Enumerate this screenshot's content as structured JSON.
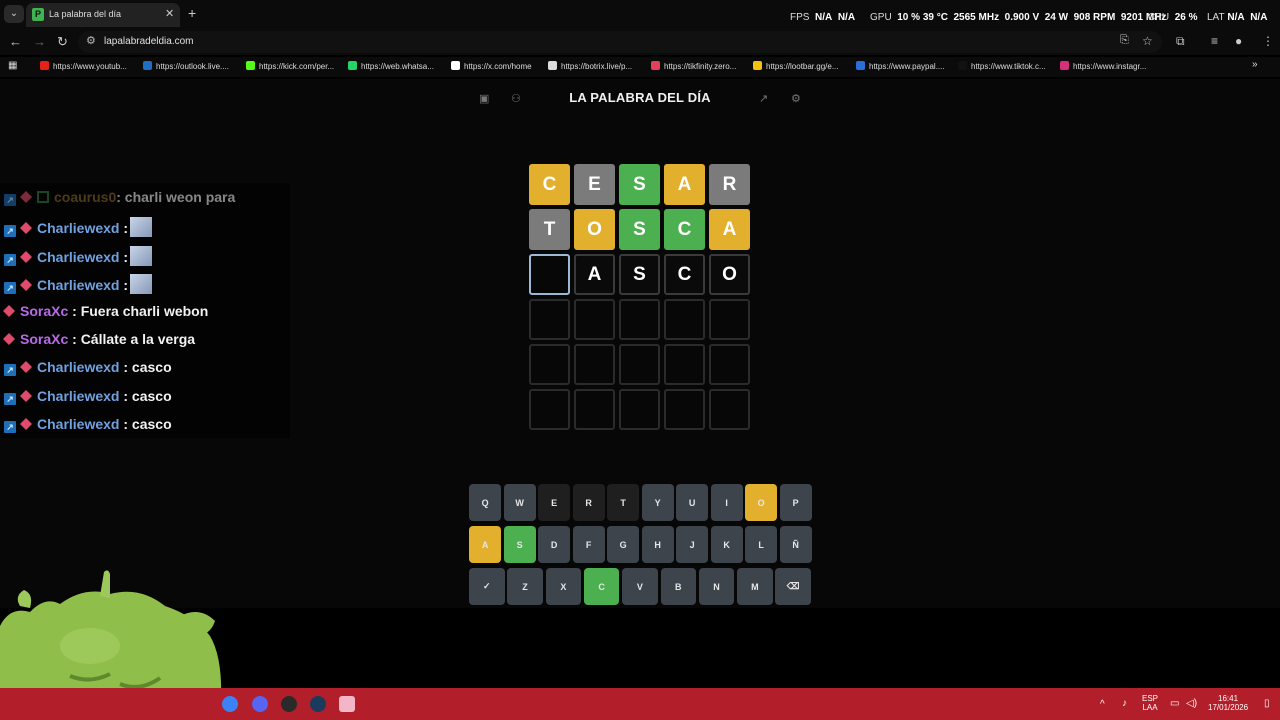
{
  "browser": {
    "tab_title": "La palabra del día",
    "tab_favicon": "P",
    "url": "lapalabradeldia.com",
    "bookmarks": [
      {
        "label": "https://www.youtub...",
        "icon": "youtube-icon",
        "color": "#e62117"
      },
      {
        "label": "https://outlook.live....",
        "icon": "outlook-icon",
        "color": "#1f6fc5"
      },
      {
        "label": "https://kick.com/per...",
        "icon": "kick-icon",
        "color": "#53fc18"
      },
      {
        "label": "https://web.whatsa...",
        "icon": "whatsapp-icon",
        "color": "#25d366"
      },
      {
        "label": "https://x.com/home",
        "icon": "x-icon",
        "color": "#ffffff"
      },
      {
        "label": "https://botrix.live/p...",
        "icon": "botrix-icon",
        "color": "#dddddd"
      },
      {
        "label": "https://tikfinity.zero...",
        "icon": "tikfinity-icon",
        "color": "#e0405a"
      },
      {
        "label": "https://lootbar.gg/e...",
        "icon": "lootbar-icon",
        "color": "#f4c20d"
      },
      {
        "label": "https://www.paypal....",
        "icon": "paypal-icon",
        "color": "#2b6fd6"
      },
      {
        "label": "https://www.tiktok.c...",
        "icon": "tiktok-icon",
        "color": "#111111"
      },
      {
        "label": "https://www.instagr...",
        "icon": "instagram-icon",
        "color": "#d6307a"
      }
    ]
  },
  "hud": {
    "fps_label": "FPS",
    "fps_value": "N/A",
    "fps_value2": "N/A",
    "gpu_label": "GPU",
    "gpu_usage": "10 %",
    "gpu_temp": "39 °C",
    "gpu_clock": "2565 MHz",
    "gpu_volt": "0.900 V",
    "gpu_power": "24 W",
    "gpu_fan": "908 RPM",
    "gpu_mem": "9201 MHz",
    "cpu_label": "CPU",
    "cpu_usage": "26 %",
    "lat_label": "LAT",
    "lat_value": "N/A",
    "lat_value2": "N/A"
  },
  "game": {
    "title": "LA PALABRA DEL DÍA",
    "rows": [
      [
        {
          "l": "C",
          "s": "y"
        },
        {
          "l": "E",
          "s": "x"
        },
        {
          "l": "S",
          "s": "g"
        },
        {
          "l": "A",
          "s": "y"
        },
        {
          "l": "R",
          "s": "x"
        }
      ],
      [
        {
          "l": "T",
          "s": "x"
        },
        {
          "l": "O",
          "s": "y"
        },
        {
          "l": "S",
          "s": "g"
        },
        {
          "l": "C",
          "s": "g"
        },
        {
          "l": "A",
          "s": "y"
        }
      ],
      [
        {
          "l": "",
          "s": "cur"
        },
        {
          "l": "A",
          "s": "typed"
        },
        {
          "l": "S",
          "s": "typed"
        },
        {
          "l": "C",
          "s": "typed"
        },
        {
          "l": "O",
          "s": "typed"
        }
      ],
      [
        {
          "l": "",
          "s": ""
        },
        {
          "l": "",
          "s": ""
        },
        {
          "l": "",
          "s": ""
        },
        {
          "l": "",
          "s": ""
        },
        {
          "l": "",
          "s": ""
        }
      ],
      [
        {
          "l": "",
          "s": ""
        },
        {
          "l": "",
          "s": ""
        },
        {
          "l": "",
          "s": ""
        },
        {
          "l": "",
          "s": ""
        },
        {
          "l": "",
          "s": ""
        }
      ],
      [
        {
          "l": "",
          "s": ""
        },
        {
          "l": "",
          "s": ""
        },
        {
          "l": "",
          "s": ""
        },
        {
          "l": "",
          "s": ""
        },
        {
          "l": "",
          "s": ""
        }
      ]
    ],
    "keyboard": [
      [
        {
          "k": "Q",
          "s": ""
        },
        {
          "k": "W",
          "s": ""
        },
        {
          "k": "E",
          "s": "x"
        },
        {
          "k": "R",
          "s": "x"
        },
        {
          "k": "T",
          "s": "x"
        },
        {
          "k": "Y",
          "s": ""
        },
        {
          "k": "U",
          "s": ""
        },
        {
          "k": "I",
          "s": ""
        },
        {
          "k": "O",
          "s": "y"
        },
        {
          "k": "P",
          "s": ""
        }
      ],
      [
        {
          "k": "A",
          "s": "y"
        },
        {
          "k": "S",
          "s": "g"
        },
        {
          "k": "D",
          "s": ""
        },
        {
          "k": "F",
          "s": ""
        },
        {
          "k": "G",
          "s": ""
        },
        {
          "k": "H",
          "s": ""
        },
        {
          "k": "J",
          "s": ""
        },
        {
          "k": "K",
          "s": ""
        },
        {
          "k": "L",
          "s": ""
        },
        {
          "k": "Ñ",
          "s": ""
        }
      ],
      [
        {
          "k": "✓",
          "s": "",
          "name": "enter-key"
        },
        {
          "k": "Z",
          "s": ""
        },
        {
          "k": "X",
          "s": ""
        },
        {
          "k": "C",
          "s": "g"
        },
        {
          "k": "V",
          "s": ""
        },
        {
          "k": "B",
          "s": ""
        },
        {
          "k": "N",
          "s": ""
        },
        {
          "k": "M",
          "s": ""
        },
        {
          "k": "⌫",
          "s": "",
          "name": "backspace-key"
        }
      ]
    ]
  },
  "chat": [
    {
      "badges": [
        "a",
        "g",
        "t"
      ],
      "user": "coaurus0",
      "color": "#8a6a2a",
      "msg": ": charli weon para",
      "dim": true
    },
    {
      "badges": [
        "a",
        "g"
      ],
      "user": "Charliewexd",
      "color": "#6fa2e0",
      "msg": " :",
      "emote": true
    },
    {
      "badges": [
        "a",
        "g"
      ],
      "user": "Charliewexd",
      "color": "#6fa2e0",
      "msg": " :",
      "emote": true
    },
    {
      "badges": [
        "a",
        "g"
      ],
      "user": "Charliewexd",
      "color": "#6fa2e0",
      "msg": " :",
      "emote": true
    },
    {
      "badges": [
        "g"
      ],
      "user": "SoraXc",
      "color": "#b86be8",
      "msg": " : Fuera charli webon"
    },
    {
      "badges": [
        "g"
      ],
      "user": "SoraXc",
      "color": "#b86be8",
      "msg": " : Cállate a la verga"
    },
    {
      "badges": [
        "a",
        "g"
      ],
      "user": "Charliewexd",
      "color": "#6fa2e0",
      "msg": " : casco"
    },
    {
      "badges": [
        "a",
        "g"
      ],
      "user": "Charliewexd",
      "color": "#6fa2e0",
      "msg": " : casco"
    },
    {
      "badges": [
        "a",
        "g"
      ],
      "user": "Charliewexd",
      "color": "#6fa2e0",
      "msg": " : casco"
    }
  ],
  "taskbar": {
    "lang": "ESP",
    "layout": "LAA",
    "time": "16:41",
    "date": "17/01/2026"
  }
}
